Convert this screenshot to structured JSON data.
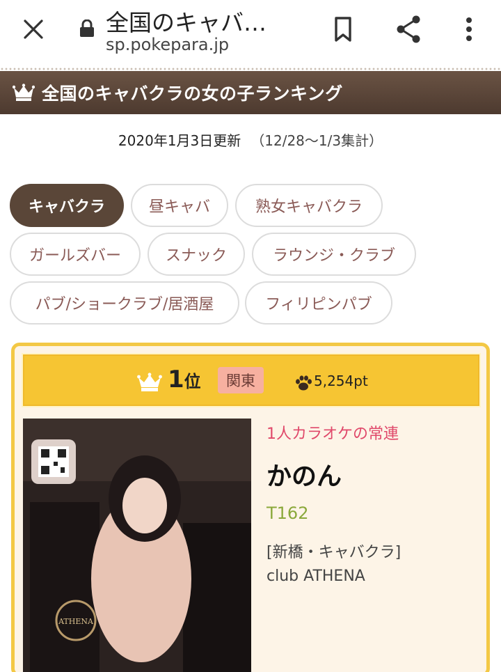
{
  "browser": {
    "title": "全国のキャバ…",
    "url": "sp.pokepara.jp"
  },
  "section": {
    "title": "全国のキャバクラの女の子ランキング"
  },
  "update": {
    "date": "2020年1月3日更新",
    "period": "（12/28〜1/3集計）"
  },
  "categories": [
    {
      "label": "キャバクラ",
      "active": true
    },
    {
      "label": "昼キャバ"
    },
    {
      "label": "熟女キャバクラ"
    },
    {
      "label": "ガールズバー"
    },
    {
      "label": "スナック"
    },
    {
      "label": "ラウンジ・クラブ"
    },
    {
      "label": "パブ/ショークラブ/居酒屋"
    },
    {
      "label": "フィリピンパブ"
    }
  ],
  "ranking": {
    "rank": "1",
    "rank_unit": "位",
    "region": "関東",
    "points": "5,254pt",
    "tagline": "1人カラオケの常連",
    "name": "かのん",
    "height": "T162",
    "location": "[新橋・キャバクラ]",
    "club": "club ATHENA"
  },
  "colors": {
    "header_brown": "#5a4638",
    "card_border": "#f3c845",
    "tagline_pink": "#e0486a",
    "height_green": "#8aa83a"
  },
  "icons": [
    "close-icon",
    "lock-icon",
    "bookmark-icon",
    "share-icon",
    "more-vert-icon",
    "crown-icon",
    "paw-icon"
  ]
}
